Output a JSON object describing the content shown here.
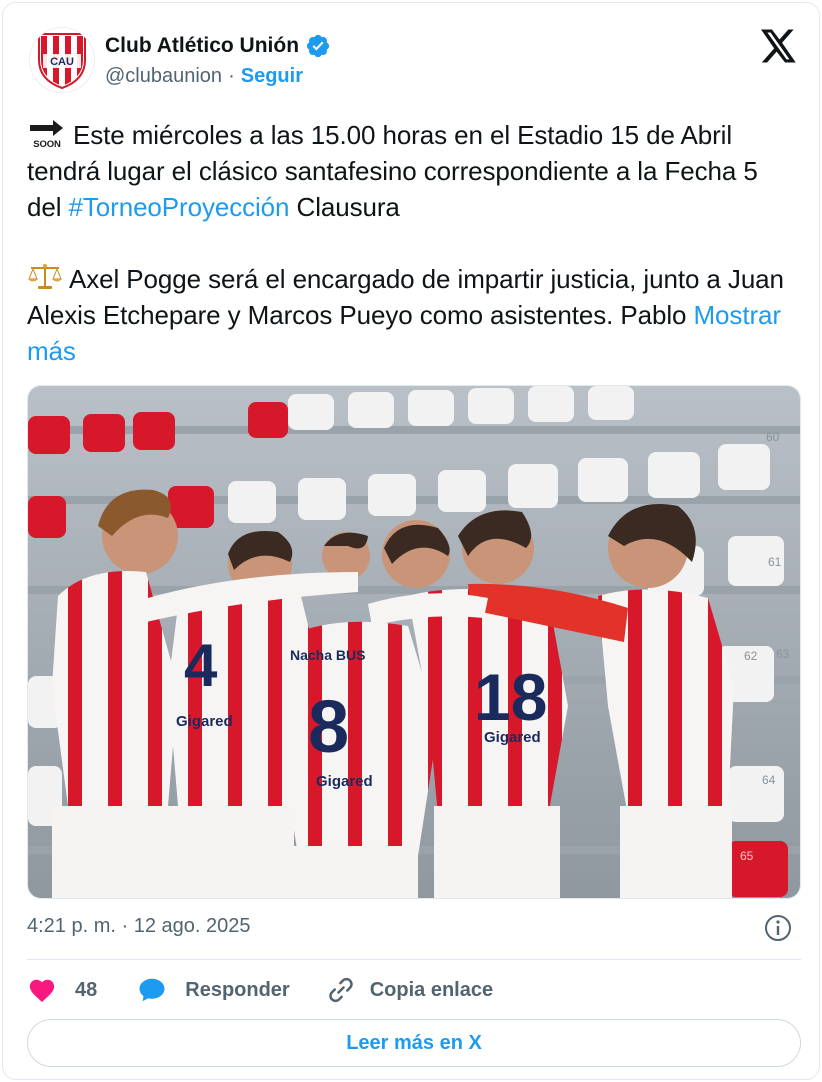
{
  "header": {
    "name": "Club Atlético Unión",
    "handle": "@clubaunion",
    "separator": "·",
    "follow_label": "Seguir",
    "avatar_letters": "CAU"
  },
  "tweet": {
    "p1_text": "Este miércoles a las 15.00 horas en el Estadio 15 de Abril tendrá lugar el clásico santafesino correspondiente a la Fecha 5 del ",
    "p1_hashtag": "#TorneoProyección",
    "p1_after": " Clausura",
    "p2_text": "Axel Pogge será el encargado de impartir justicia, junto a Juan Alexis Etchepare y Marcos Pueyo como asistentes. Pablo ",
    "show_more": "Mostrar más",
    "soon_label": "SOON"
  },
  "media": {
    "jersey_numbers": [
      "4",
      "8",
      "18"
    ],
    "seat_numbers": [
      "60",
      "61",
      "62",
      "63",
      "64",
      "65"
    ],
    "sponsor": "Gigared",
    "sponsor2": "Nacha BUS"
  },
  "meta": {
    "timestamp": "4:21 p. m. · 12 ago. 2025"
  },
  "actions": {
    "likes": "48",
    "reply_label": "Responder",
    "copy_label": "Copia enlace"
  },
  "read_more_label": "Leer más en X",
  "colors": {
    "link": "#1d9bf0",
    "like": "#f91880",
    "text": "#0f1419",
    "muted": "#536471",
    "club_red": "#d7182a"
  },
  "icons": {
    "verified": "verified-badge-icon",
    "x_logo": "x-logo-icon",
    "soon": "soon-arrow-icon",
    "scales": "balance-scale-icon",
    "info": "info-icon",
    "heart": "heart-icon",
    "reply": "speech-bubble-icon",
    "link": "link-icon"
  }
}
